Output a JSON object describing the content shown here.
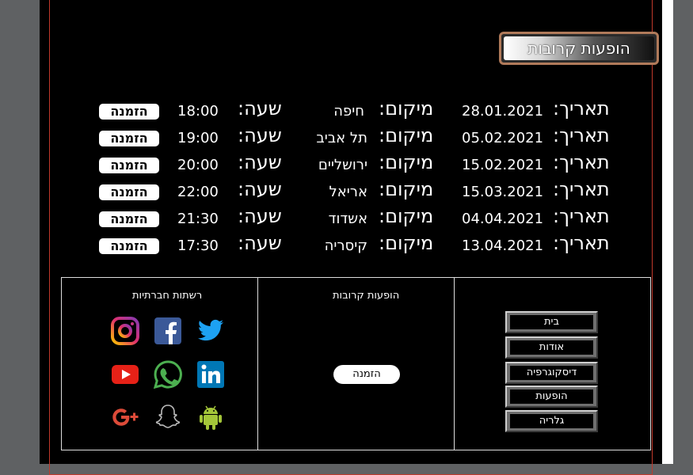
{
  "header": {
    "title": "הופעות קרובות"
  },
  "labels": {
    "date": "תאריך:",
    "location": "מיקום:",
    "time": "שעה:",
    "book": "הזמנה"
  },
  "shows": [
    {
      "date": "28.01.2021",
      "location": "חיפה",
      "time": "18:00"
    },
    {
      "date": "05.02.2021",
      "location": "תל אביב",
      "time": "19:00"
    },
    {
      "date": "15.02.2021",
      "location": "ירושליים",
      "time": "20:00"
    },
    {
      "date": "15.03.2021",
      "location": "אריאל",
      "time": "22:00"
    },
    {
      "date": "04.04.2021",
      "location": "אשדוד",
      "time": "21:30"
    },
    {
      "date": "13.04.2021",
      "location": "קיסריה",
      "time": "17:30"
    }
  ],
  "footer": {
    "social_title": "רשתות חברתיות",
    "upcoming_title": "הופעות קרובות",
    "book_label": "הזמנה",
    "nav": [
      "בית",
      "אודות",
      "דיסקוגרפיה",
      "הופעות",
      "גלריה"
    ],
    "social_icons": [
      "twitter-icon",
      "facebook-icon",
      "instagram-icon",
      "linkedin-icon",
      "whatsapp-icon",
      "youtube-icon",
      "android-icon",
      "snapchat-icon",
      "google-plus-icon"
    ]
  },
  "colors": {
    "accent": "#c0392b",
    "title_border": "#b07a5a",
    "background": "#000000"
  }
}
